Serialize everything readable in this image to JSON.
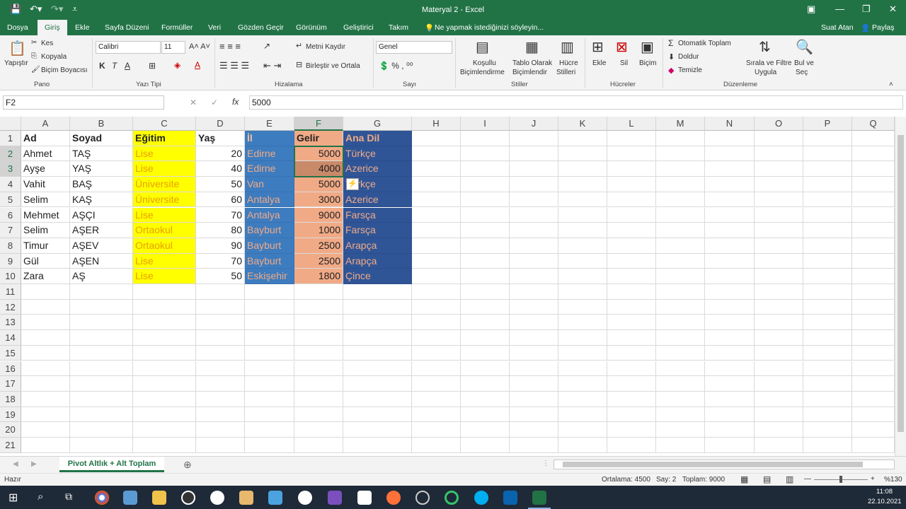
{
  "title": "Materyal 2 - Excel",
  "tabs": [
    "Dosya",
    "Giriş",
    "Ekle",
    "Sayfa Düzeni",
    "Formüller",
    "Veri",
    "Gözden Geçir",
    "Görünüm",
    "Geliştirici",
    "Takım"
  ],
  "tell_me": "Ne yapmak istediğinizi söyleyin...",
  "user": "Suat Atan",
  "share": "Paylaş",
  "ribbon": {
    "paste": "Yapıştır",
    "cut": "Kes",
    "copy": "Kopyala",
    "format_painter": "Biçim Boyacısı",
    "group_clipboard": "Pano",
    "font_name": "Calibri",
    "font_size": "11",
    "group_font": "Yazı Tipi",
    "wrap_text": "Metni Kaydır",
    "merge_center": "Birleştir ve Ortala",
    "group_alignment": "Hizalama",
    "number_format": "Genel",
    "group_number": "Sayı",
    "cond_format_1": "Koşullu",
    "cond_format_2": "Biçimlendirme",
    "format_table_1": "Tablo Olarak",
    "format_table_2": "Biçimlendir",
    "cell_styles_1": "Hücre",
    "cell_styles_2": "Stilleri",
    "group_styles": "Stiller",
    "insert": "Ekle",
    "delete": "Sil",
    "format": "Biçim",
    "group_cells": "Hücreler",
    "autosum": "Otomatik Toplam",
    "fill": "Doldur",
    "clear": "Temizle",
    "sort_filter_1": "Sırala ve Filtre",
    "sort_filter_2": "Uygula",
    "find_select_1": "Bul ve",
    "find_select_2": "Seç",
    "group_editing": "Düzenleme"
  },
  "name_box": "F2",
  "formula": "5000",
  "columns": [
    "A",
    "B",
    "C",
    "D",
    "E",
    "F",
    "G",
    "H",
    "I",
    "J",
    "K",
    "L",
    "M",
    "N",
    "O",
    "P",
    "Q"
  ],
  "rows": [
    "1",
    "2",
    "3",
    "4",
    "5",
    "6",
    "7",
    "8",
    "9",
    "10",
    "11",
    "12",
    "13",
    "14",
    "15",
    "16",
    "17",
    "18",
    "19",
    "20",
    "21"
  ],
  "table": {
    "headers": [
      "Ad",
      "Soyad",
      "Eğitim",
      "Yaş",
      "İl",
      "Gelir",
      "Ana Dil"
    ],
    "data": [
      [
        "Ahmet",
        "TAŞ",
        "Lise",
        "20",
        "Edirne",
        "5000",
        "Türkçe"
      ],
      [
        "Ayşe",
        "YAŞ",
        "Lise",
        "40",
        "Edirne",
        "4000",
        "Azerice"
      ],
      [
        "Vahit",
        "BAŞ",
        "Üniversite",
        "50",
        "Van",
        "5000",
        "Türkçe"
      ],
      [
        "Selim",
        "KAŞ",
        "Üniversite",
        "60",
        "Antalya",
        "3000",
        "Azerice"
      ],
      [
        "Mehmet",
        "AŞÇI",
        "Lise",
        "70",
        "Antalya",
        "9000",
        "Farsça"
      ],
      [
        "Selim",
        "AŞER",
        "Ortaokul",
        "80",
        "Bayburt",
        "1000",
        "Farsça"
      ],
      [
        "Timur",
        "AŞEV",
        "Ortaokul",
        "90",
        "Bayburt",
        "2500",
        "Arapça"
      ],
      [
        "Gül",
        "AŞEN",
        "Lise",
        "70",
        "Bayburt",
        "2500",
        "Arapça"
      ],
      [
        "Zara",
        "AŞ",
        "Lise",
        "50",
        "Eskişehir",
        "1800",
        "Çince"
      ]
    ]
  },
  "sheet_tab": "Pivot Altlık + Alt Toplam",
  "status": {
    "ready": "Hazır",
    "average": "Ortalama: 4500",
    "count": "Say: 2",
    "sum": "Toplam: 9000",
    "zoom": "%130"
  },
  "clock": {
    "time": "11:08",
    "date": "22.10.2021"
  },
  "colors": {
    "excel_green": "#217346",
    "yellow": "#ffff00",
    "blue": "#3d7cbf",
    "salmon": "#f1aa86",
    "darkblue": "#2f5597"
  }
}
